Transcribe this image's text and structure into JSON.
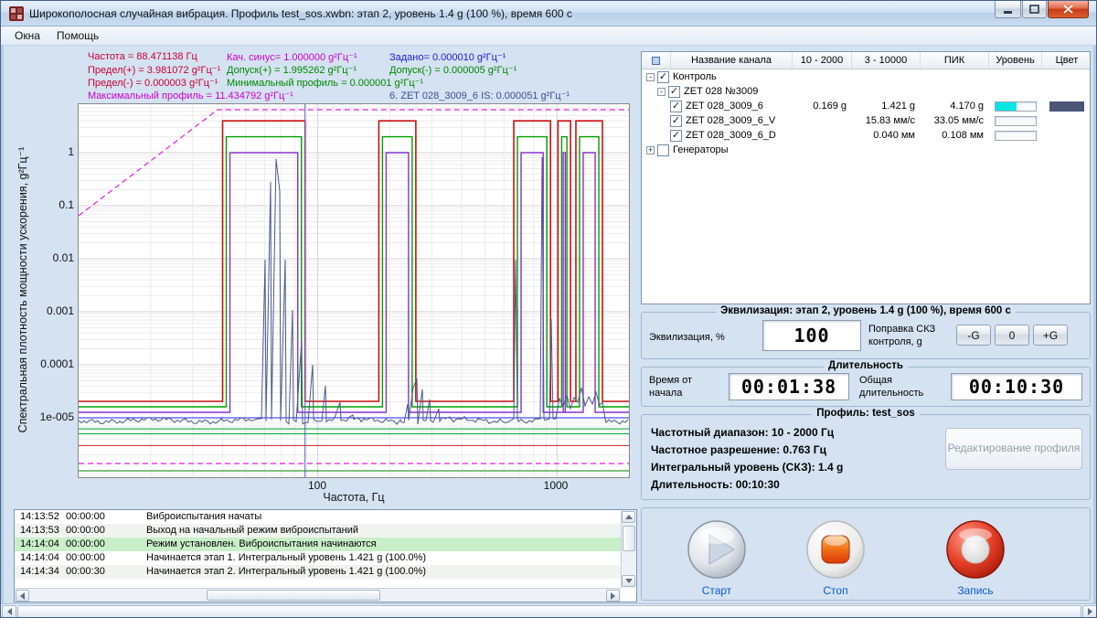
{
  "window": {
    "title": "Широкополосная случайная вибрация. Профиль test_sos.xwbn: этап 2, уровень 1.4 g (100 %), время 600 с"
  },
  "menu": {
    "items": [
      {
        "label": "Окна"
      },
      {
        "label": "Помощь"
      }
    ]
  },
  "icons": {
    "check": "✓",
    "collapse": "-",
    "expand": "+"
  },
  "chart": {
    "annotations": {
      "frequency": "Частота = 88.471138 Гц",
      "sweep_sine": "Кач. синус= 1.000000 g²Гц⁻¹",
      "setpoint": "Задано= 0.000010 g²Гц⁻¹",
      "limit_plus": "Предел(+) = 3.981072 g²Гц⁻¹",
      "tolerance_plus": "Допуск(+) = 1.995262 g²Гц⁻¹",
      "tolerance_minus": "Допуск(-) = 0.000005 g²Гц⁻¹",
      "limit_minus": "Предел(-) = 0.000003 g²Гц⁻¹",
      "min_profile": "Минимальный профиль = 0.000001 g²Гц⁻¹",
      "max_profile": "Максимальный профиль = 11.434792 g²Гц⁻¹",
      "channel_is": "6. ZET 028_3009_6 IS: 0.000051 g²Гц⁻¹"
    },
    "y_axis_label": "Спектральная плотность мощности ускорения, g²Гц⁻¹",
    "x_axis_label": "Частота, Гц",
    "y_ticks": [
      "1",
      "0.1",
      "0.01",
      "0.001",
      "0.0001",
      "1e-005"
    ],
    "x_ticks": [
      "100",
      "1000"
    ]
  },
  "log": {
    "rows": [
      {
        "time": "14:13:52",
        "elapsed": "00:00:00",
        "message": "Виброиспытания начаты"
      },
      {
        "time": "14:13:53",
        "elapsed": "00:00:00",
        "message": "Выход на начальный режим виброиспытаний"
      },
      {
        "time": "14:14:04",
        "elapsed": "00:00:00",
        "message": "Режим установлен. Виброиспытания начинаются"
      },
      {
        "time": "14:14:04",
        "elapsed": "00:00:00",
        "message": "Начинается этап 1. Интегральный уровень 1.421 g (100.0%)"
      },
      {
        "time": "14:14:34",
        "elapsed": "00:00:30",
        "message": "Начинается этап 2. Интегральный уровень 1.421 g (100.0%)"
      }
    ]
  },
  "channels": {
    "headers": [
      "Название канала",
      "10 - 2000",
      "3 - 10000",
      "ПИК",
      "Уровень",
      "Цвет"
    ],
    "group_label": "Контроль",
    "device_label": "ZET 028 №3009",
    "generators_label": "Генераторы",
    "rows": [
      {
        "name": "ZET 028_3009_6",
        "band": "0.169 g",
        "wide": "1.421 g",
        "peak": "4.170 g",
        "level_fill": "52%",
        "level_color": "#00e5e5",
        "color": "#4a5578"
      },
      {
        "name": "ZET 028_3009_6_V",
        "band": "",
        "wide": "15.83 мм/с",
        "peak": "33.05 мм/с",
        "level_fill": "0%",
        "level_color": "",
        "color": ""
      },
      {
        "name": "ZET 028_3009_6_D",
        "band": "",
        "wide": "0.040 мм",
        "peak": "0.108 мм",
        "level_fill": "0%",
        "level_color": "",
        "color": ""
      }
    ]
  },
  "equalization": {
    "group_title": "Эквилизация: этап 2, уровень 1.4 g (100 %), время 600 с",
    "label": "Эквилизация, %",
    "value": "100",
    "correction_label": "Поправка СКЗ контроля, g",
    "minus_g": "-G",
    "zero": "0",
    "plus_g": "+G"
  },
  "duration": {
    "group_title": "Длительность",
    "elapsed_label": "Время от начала",
    "elapsed_value": "00:01:38",
    "total_label": "Общая длительность",
    "total_value": "00:10:30"
  },
  "profile": {
    "group_title": "Профиль: test_sos",
    "lines": [
      "Частотный диапазон: 10 - 2000 Гц",
      "Частотное разрешение: 0.763 Гц",
      "Интегральный уровень (СКЗ): 1.4 g",
      "Длительность: 00:10:30"
    ],
    "edit_button": "Редактирование профиля"
  },
  "controls": {
    "start": "Старт",
    "stop": "Стоп",
    "record": "Запись"
  }
}
